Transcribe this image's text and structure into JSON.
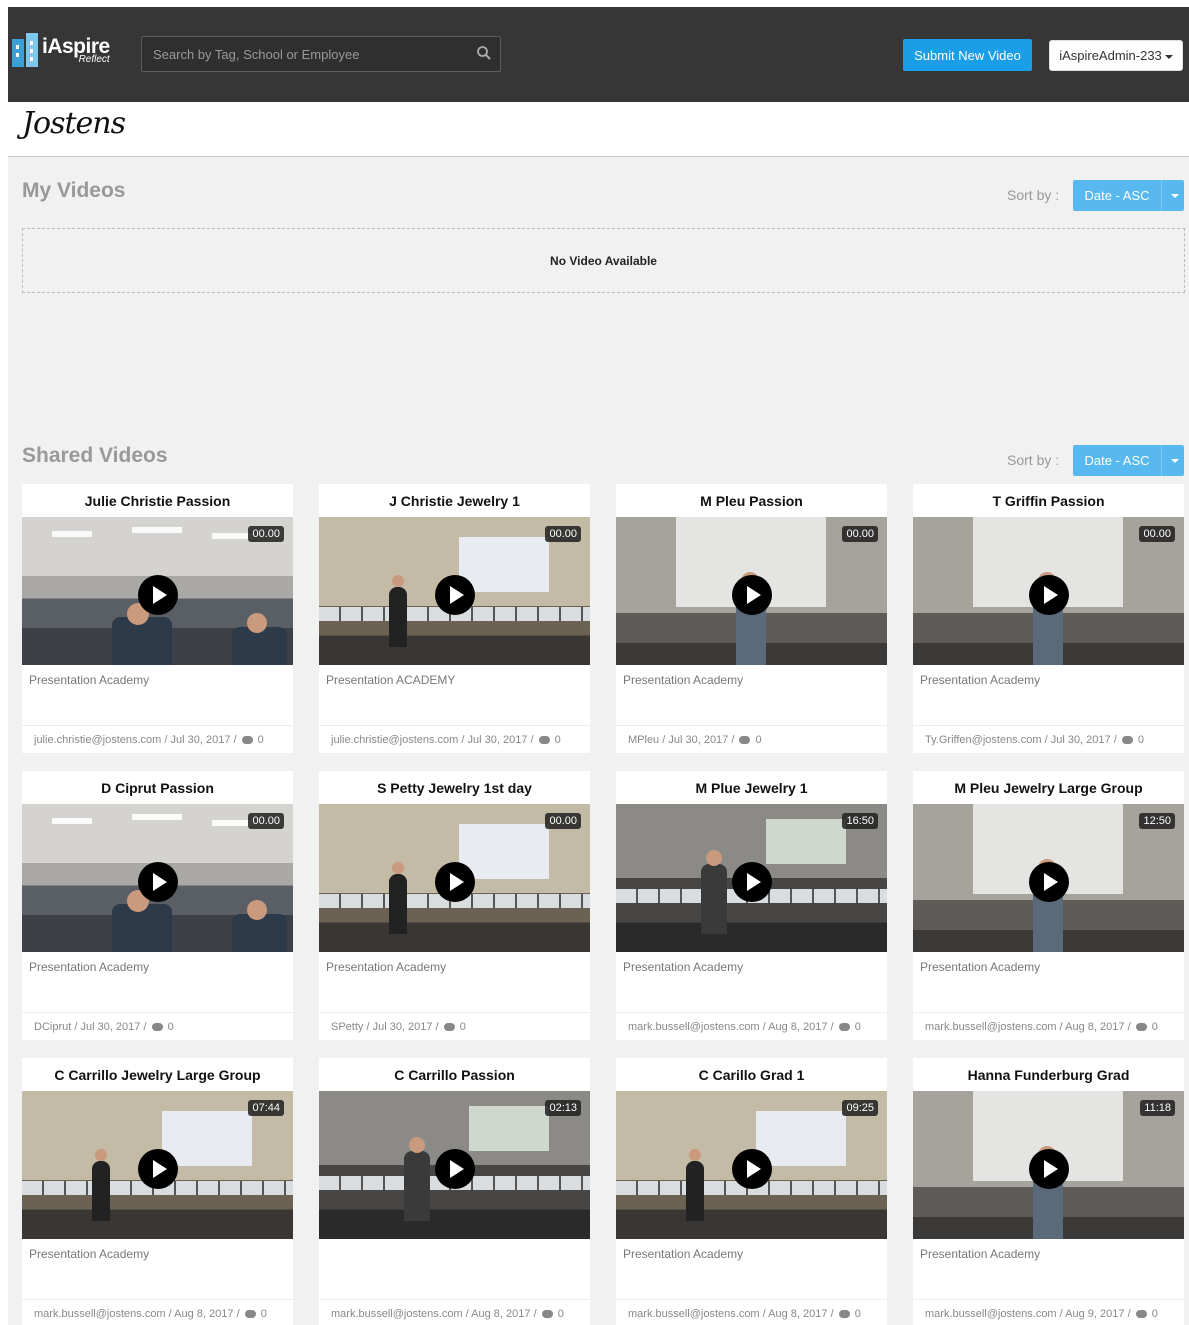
{
  "nav": {
    "logo_main": "iAspire",
    "logo_sub": "Reflect",
    "search_placeholder": "Search by Tag, School or Employee",
    "submit_button": "Submit New Video",
    "user_menu": "iAspireAdmin-233"
  },
  "brand": {
    "logo_text": "Jostens"
  },
  "my_videos": {
    "title": "My Videos",
    "sort_label": "Sort by :",
    "sort_value": "Date - ASC",
    "empty_message": "No Video Available"
  },
  "shared_videos": {
    "title": "Shared Videos",
    "sort_label": "Sort by :",
    "sort_value": "Date - ASC",
    "items": [
      {
        "title": "Julie Christie Passion",
        "duration": "00.00",
        "category": "Presentation Academy",
        "author": "julie.christie@jostens.com",
        "date": "Jul 30, 2017",
        "comments": "0",
        "scene": "ceiling"
      },
      {
        "title": "J Christie Jewelry 1",
        "duration": "00.00",
        "category": "Presentation ACADEMY",
        "author": "julie.christie@jostens.com",
        "date": "Jul 30, 2017",
        "comments": "0",
        "scene": "room"
      },
      {
        "title": "M Pleu Passion",
        "duration": "00.00",
        "category": "Presentation Academy",
        "author": "MPleu",
        "date": "Jul 30, 2017",
        "comments": "0",
        "scene": "screen"
      },
      {
        "title": "T Griffin Passion",
        "duration": "00.00",
        "category": "Presentation Academy",
        "author": "Ty.Griffen@jostens.com",
        "date": "Jul 30, 2017",
        "comments": "0",
        "scene": "screen"
      },
      {
        "title": "D Ciprut Passion",
        "duration": "00.00",
        "category": "Presentation Academy",
        "author": "DCiprut",
        "date": "Jul 30, 2017",
        "comments": "0",
        "scene": "ceiling"
      },
      {
        "title": "S Petty Jewelry 1st day",
        "duration": "00.00",
        "category": "Presentation Academy",
        "author": "SPetty",
        "date": "Jul 30, 2017",
        "comments": "0",
        "scene": "room"
      },
      {
        "title": "M Plue Jewelry 1",
        "duration": "16:50",
        "category": "Presentation Academy",
        "author": "mark.bussell@jostens.com",
        "date": "Aug 8, 2017",
        "comments": "0",
        "scene": "dark"
      },
      {
        "title": "M Pleu Jewelry Large Group",
        "duration": "12:50",
        "category": "Presentation Academy",
        "author": "mark.bussell@jostens.com",
        "date": "Aug 8, 2017",
        "comments": "0",
        "scene": "screen"
      },
      {
        "title": "C Carrillo Jewelry Large Group",
        "duration": "07:44",
        "category": "Presentation Academy",
        "author": "mark.bussell@jostens.com",
        "date": "Aug 8, 2017",
        "comments": "0",
        "scene": "room"
      },
      {
        "title": "C Carrillo Passion",
        "duration": "02:13",
        "category": "",
        "author": "mark.bussell@jostens.com",
        "date": "Aug 8, 2017",
        "comments": "0",
        "scene": "dark"
      },
      {
        "title": "C Carillo Grad 1",
        "duration": "09:25",
        "category": "Presentation Academy",
        "author": "mark.bussell@jostens.com",
        "date": "Aug 8, 2017",
        "comments": "0",
        "scene": "room"
      },
      {
        "title": "Hanna Funderburg Grad",
        "duration": "11:18",
        "category": "Presentation Academy",
        "author": "mark.bussell@jostens.com",
        "date": "Aug 9, 2017",
        "comments": "0",
        "scene": "screen"
      }
    ]
  }
}
